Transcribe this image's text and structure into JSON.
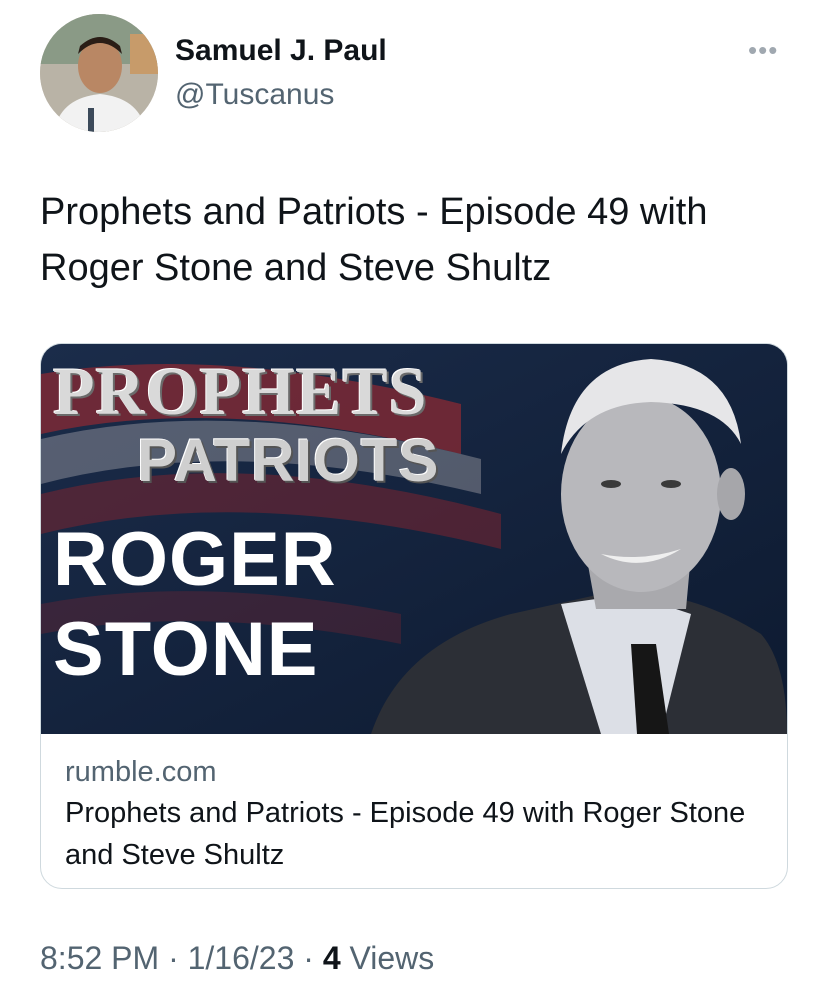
{
  "author": {
    "name": "Samuel J. Paul",
    "handle": "@Tuscanus"
  },
  "more_icon": "more-horizontal-icon",
  "tweet": {
    "text": "Prophets and Patriots - Episode 49 with Roger Stone and Steve Shultz"
  },
  "card": {
    "image_title_line1": "PROPHETS",
    "image_title_line2": "PATRIOTS",
    "image_name_line1": "ROGER",
    "image_name_line2": "STONE",
    "domain": "rumble.com",
    "description": "Prophets and Patriots - Episode 49 with Roger Stone and Steve Shultz"
  },
  "meta": {
    "time": "8:52 PM",
    "separator1": " · ",
    "date": "1/16/23",
    "separator2": " · ",
    "views_count": "4",
    "views_label": " Views"
  },
  "colors": {
    "text": "#0f1419",
    "secondary": "#536471",
    "border": "#cfd9de",
    "card_bg": "#16243e"
  }
}
